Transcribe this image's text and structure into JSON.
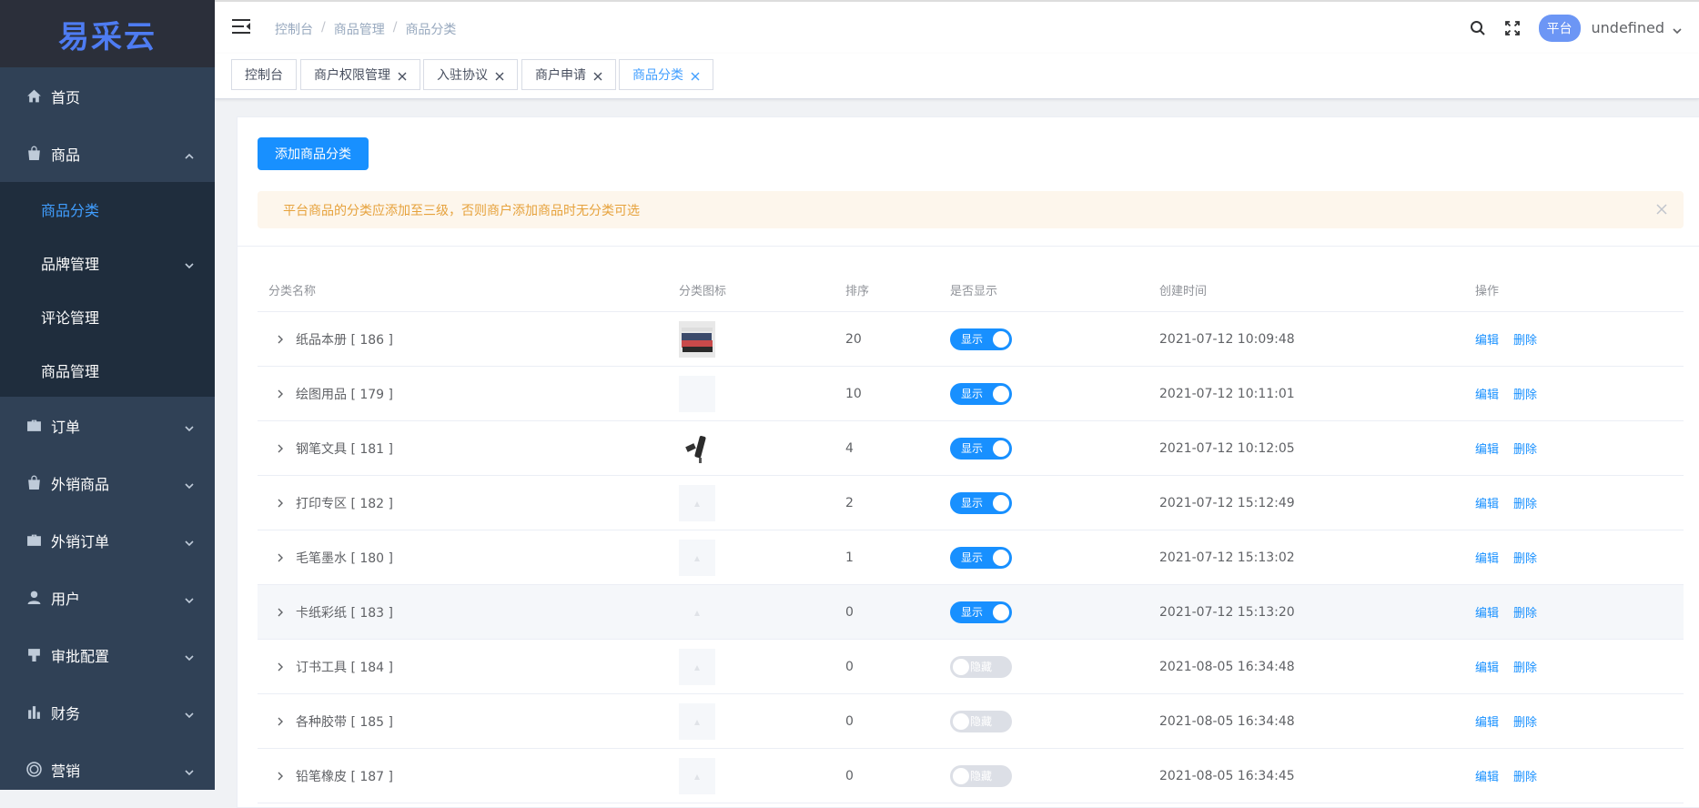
{
  "sidebar": {
    "logo": "易采云",
    "home": "首页",
    "goods": "商品",
    "goods_sub": [
      "商品分类",
      "品牌管理",
      "评论管理",
      "商品管理"
    ],
    "orders": "订单",
    "ext_goods": "外销商品",
    "ext_orders": "外销订单",
    "users": "用户",
    "approval": "审批配置",
    "finance": "财务",
    "marketing": "营销"
  },
  "header": {
    "breadcrumb": [
      "控制台",
      "商品管理",
      "商品分类"
    ],
    "platform": "平台",
    "username": "undefined"
  },
  "tags": [
    "控制台",
    "商户权限管理",
    "入驻协议",
    "商户申请",
    "商品分类"
  ],
  "main": {
    "add_button": "添加商品分类",
    "alert": "平台商品的分类应添加至三级，否则商户添加商品时无分类可选"
  },
  "table": {
    "columns": [
      "分类名称",
      "分类图标",
      "排序",
      "是否显示",
      "创建时间",
      "操作"
    ],
    "edit_label": "编辑",
    "delete_label": "删除",
    "on_label": "显示",
    "off_label": "隐藏",
    "rows": [
      {
        "name": "纸品本册 [ 186 ]",
        "sort": "20",
        "show": "显示",
        "time": "2021-07-12 10:09:48",
        "icon": "notebook-thumb"
      },
      {
        "name": "绘图用品 [ 179 ]",
        "sort": "10",
        "show": "显示",
        "time": "2021-07-12 10:11:01",
        "icon": "blank-thumb"
      },
      {
        "name": "钢笔文具 [ 181 ]",
        "sort": "4",
        "show": "显示",
        "time": "2021-07-12 10:12:05",
        "icon": "pen-thumb"
      },
      {
        "name": "打印专区 [ 182 ]",
        "sort": "2",
        "show": "显示",
        "time": "2021-07-12 15:12:49",
        "icon": "placeholder-thumb"
      },
      {
        "name": "毛笔墨水 [ 180 ]",
        "sort": "1",
        "show": "显示",
        "time": "2021-07-12 15:13:02",
        "icon": "placeholder-thumb"
      },
      {
        "name": "卡纸彩纸 [ 183 ]",
        "sort": "0",
        "show": "显示",
        "time": "2021-07-12 15:13:20",
        "icon": "placeholder-thumb"
      },
      {
        "name": "订书工具 [ 184 ]",
        "sort": "0",
        "show": "隐藏",
        "time": "2021-08-05 16:34:48",
        "icon": "placeholder-thumb"
      },
      {
        "name": "各种胶带 [ 185 ]",
        "sort": "0",
        "show": "隐藏",
        "time": "2021-08-05 16:34:48",
        "icon": "placeholder-thumb"
      },
      {
        "name": "铅笔橡皮 [ 187 ]",
        "sort": "0",
        "show": "隐藏",
        "time": "2021-08-05 16:34:45",
        "icon": "placeholder-thumb"
      }
    ]
  },
  "colors": {
    "sidebar_bg": "#304156",
    "primary": "#1890ff",
    "alert_bg": "#fdf6ec",
    "alert_text": "#e6a23c"
  }
}
